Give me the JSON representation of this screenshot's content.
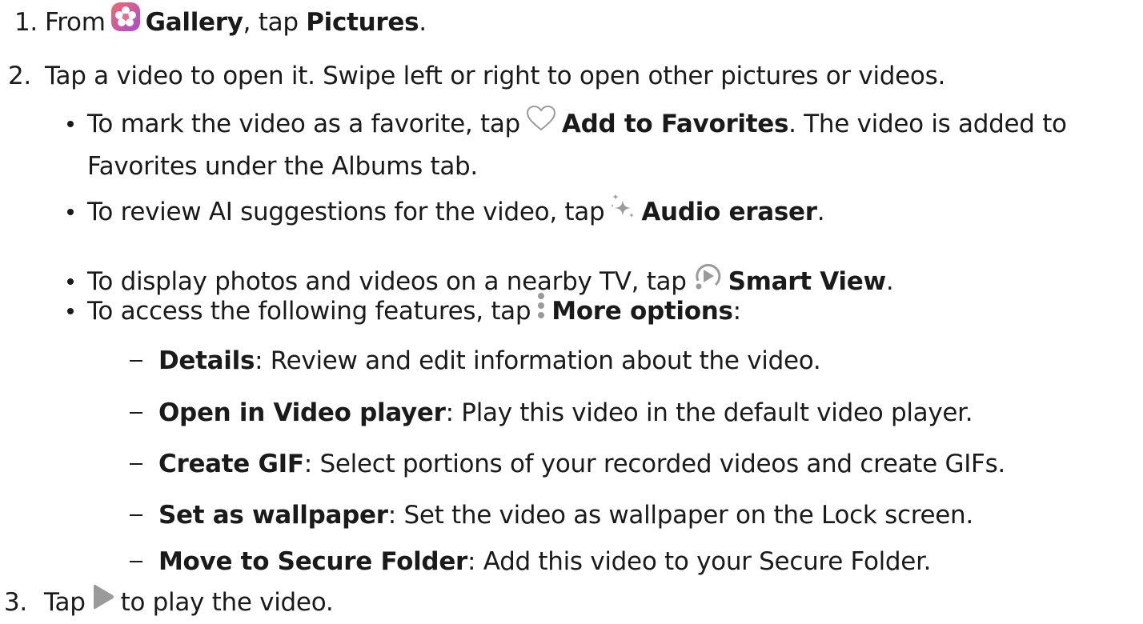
{
  "steps": {
    "s1": {
      "num": "1.",
      "pre": "From",
      "gallery": "Gallery",
      "mid": ", tap ",
      "pictures": "Pictures",
      "end": "."
    },
    "s2": {
      "num": "2.",
      "text": "Tap a video to open it. Swipe left or right to open other pictures or videos."
    },
    "s3": {
      "num": "3.",
      "pre": "Tap",
      "post": "to play the video."
    }
  },
  "bullets": {
    "fav": {
      "pre": "To mark the video as a favorite, tap",
      "label": "Add to Favorites",
      "post": ". The video is added to",
      "line2": "Favorites under the Albums tab."
    },
    "ai": {
      "pre": "To review AI suggestions for the video, tap",
      "label": "Audio eraser",
      "post": "."
    },
    "tv": {
      "pre": "To display photos and videos on a nearby TV, tap",
      "label": "Smart View",
      "post": "."
    },
    "more": {
      "pre": "To access the following features, tap",
      "label": "More options",
      "post": ":"
    }
  },
  "subitems": [
    {
      "label": "Details",
      "text": ": Review and edit information about the video."
    },
    {
      "label": "Open in Video player",
      "text": ": Play this video in the default video player."
    },
    {
      "label": "Create GIF",
      "text": ": Select portions of your recorded videos and create GIFs."
    },
    {
      "label": "Set as wallpaper",
      "text": ": Set the video as wallpaper on the Lock screen."
    },
    {
      "label": "Move to Secure Folder",
      "text": ": Add this video to your Secure Folder."
    }
  ],
  "icons": {
    "gallery": "gallery-icon",
    "heart": "heart-icon",
    "sparkle": "sparkle-icon",
    "smartview": "smart-view-icon",
    "more": "more-options-icon",
    "play": "play-icon"
  },
  "colors": {
    "text": "#1a1a1a",
    "icon_gray": "#9a9a9a",
    "gallery_gradient_top": "#f05a7a",
    "gallery_gradient_bottom": "#b04dd8"
  }
}
